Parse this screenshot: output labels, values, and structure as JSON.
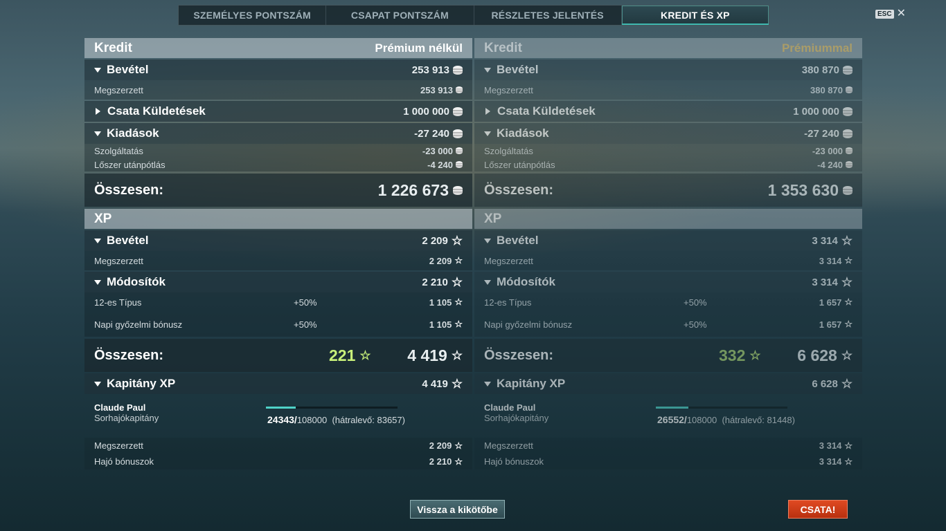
{
  "tabs": [
    "SZEMÉLYES PONTSZÁM",
    "CSAPAT PONTSZÁM",
    "RÉSZLETES JELENTÉS",
    "KREDIT ÉS XP"
  ],
  "esc_label": "ESC",
  "colors": {
    "accent": "#3fb8b0",
    "premium": "#e8c36a",
    "bonus": "#c8f07a",
    "battle": "#d03c18"
  },
  "left": {
    "credit": {
      "title": "Kredit",
      "sub": "Prémium nélkül",
      "income": {
        "label": "Bevétel",
        "value": "253 913"
      },
      "earned": {
        "label": "Megszerzett",
        "value": "253 913"
      },
      "missions": {
        "label": "Csata Küldetések",
        "value": "1 000 000"
      },
      "expenses": {
        "label": "Kiadások",
        "value": "-27 240"
      },
      "service": {
        "label": "Szolgáltatás",
        "value": "-23 000"
      },
      "ammo": {
        "label": "Lőszer utánpótlás",
        "value": "-4 240"
      },
      "total": {
        "label": "Összesen:",
        "value": "1 226 673"
      }
    },
    "xp": {
      "title": "XP",
      "income": {
        "label": "Bevétel",
        "value": "2 209"
      },
      "earned": {
        "label": "Megszerzett",
        "value": "2 209"
      },
      "modifiers": {
        "label": "Módosítók",
        "value": "2 210"
      },
      "type12": {
        "label": "12-es Típus",
        "pct": "+50%",
        "value": "1 105"
      },
      "daily": {
        "label": "Napi győzelmi bónusz",
        "pct": "+50%",
        "value": "1 105"
      },
      "total": {
        "label": "Összesen:",
        "bonus": "221",
        "value": "4 419"
      }
    },
    "captain": {
      "title": "Kapitány XP",
      "value": "4 419",
      "name": "Claude Paul",
      "rank": "Sorhajókapitány",
      "current": "24343/",
      "max": "108000",
      "remaining": "(hátralevő: 83657)",
      "progress": 0.225,
      "earned": {
        "label": "Megszerzett",
        "value": "2 209"
      },
      "ship": {
        "label": "Hajó bónuszok",
        "value": "2 210"
      }
    }
  },
  "right": {
    "credit": {
      "title": "Kredit",
      "sub": "Prémiummal",
      "income": {
        "label": "Bevétel",
        "value": "380 870"
      },
      "earned": {
        "label": "Megszerzett",
        "value": "380 870"
      },
      "missions": {
        "label": "Csata Küldetések",
        "value": "1 000 000"
      },
      "expenses": {
        "label": "Kiadások",
        "value": "-27 240"
      },
      "service": {
        "label": "Szolgáltatás",
        "value": "-23 000"
      },
      "ammo": {
        "label": "Lőszer utánpótlás",
        "value": "-4 240"
      },
      "total": {
        "label": "Összesen:",
        "value": "1 353 630"
      }
    },
    "xp": {
      "title": "XP",
      "income": {
        "label": "Bevétel",
        "value": "3 314"
      },
      "earned": {
        "label": "Megszerzett",
        "value": "3 314"
      },
      "modifiers": {
        "label": "Módosítók",
        "value": "3 314"
      },
      "type12": {
        "label": "12-es Típus",
        "pct": "+50%",
        "value": "1 657"
      },
      "daily": {
        "label": "Napi győzelmi bónusz",
        "pct": "+50%",
        "value": "1 657"
      },
      "total": {
        "label": "Összesen:",
        "bonus": "332",
        "value": "6 628"
      }
    },
    "captain": {
      "title": "Kapitány XP",
      "value": "6 628",
      "name": "Claude Paul",
      "rank": "Sorhajókapitány",
      "current": "26552/",
      "max": "108000",
      "remaining": "(hátralevő: 81448)",
      "progress": 0.245,
      "earned": {
        "label": "Megszerzett",
        "value": "3 314"
      },
      "ship": {
        "label": "Hajó bónuszok",
        "value": "3 314"
      }
    }
  },
  "buttons": {
    "back": "Vissza a kikötőbe",
    "battle": "CSATA!"
  }
}
